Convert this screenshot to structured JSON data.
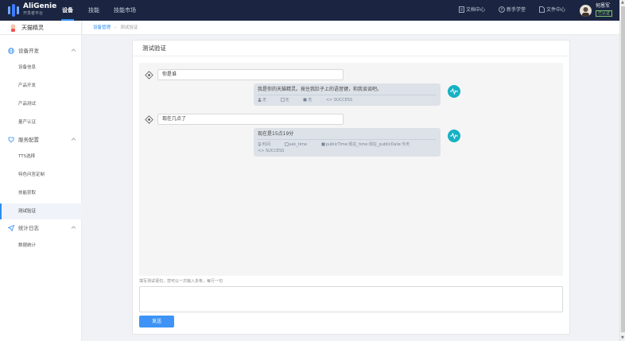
{
  "brand": {
    "name": "AliGenie",
    "subtitle": "开发者平台"
  },
  "topnav": [
    {
      "label": "设备",
      "active": true
    },
    {
      "label": "技能",
      "active": false
    },
    {
      "label": "技能市场",
      "active": false
    }
  ],
  "topright": {
    "docs": "文档中心",
    "newbie": "新手学堂",
    "files": "文件中心",
    "username": "何恩军",
    "badge": "已认证"
  },
  "sidebar": {
    "home": "天猫精灵",
    "groups": [
      {
        "label": "设备开发",
        "icon": "globe-icon",
        "items": [
          "设备信息",
          "产品开发",
          "产品测试",
          "量产认证"
        ]
      },
      {
        "label": "服务配置",
        "icon": "trophy-icon",
        "items": [
          "TTS选择",
          "特色问答定制",
          "技能获取",
          "测试验证"
        ]
      },
      {
        "label": "统计日志",
        "icon": "send-icon",
        "items": [
          "数据统计"
        ]
      }
    ],
    "active_item": "测试验证"
  },
  "breadcrumb": {
    "parent": "设备管理",
    "current": "测试验证"
  },
  "card": {
    "title": "测试验证"
  },
  "conversation": [
    {
      "query": "你是谁",
      "reply": "我是你的天猫精灵。按住我肚子上的语音键，和我谈谈吧。",
      "meta": [
        "无",
        "无",
        "无",
        "<> SUCCESS"
      ]
    },
    {
      "query": "现在几点了",
      "reply": "现在是15点19分",
      "meta": [
        "时间",
        "ask_time",
        "publicTime:现在_time:现在_publicDate:今天"
      ],
      "status": "<> SUCCESS"
    }
  ],
  "form": {
    "hint": "填写测试语句，您可以一次输入多条，每行一句",
    "send_label": "发送"
  },
  "colors": {
    "topbar": "#1b2541",
    "primary": "#3d94f6",
    "bot_avatar": "#16b1c4",
    "active_nav": "#2d8cf0"
  }
}
